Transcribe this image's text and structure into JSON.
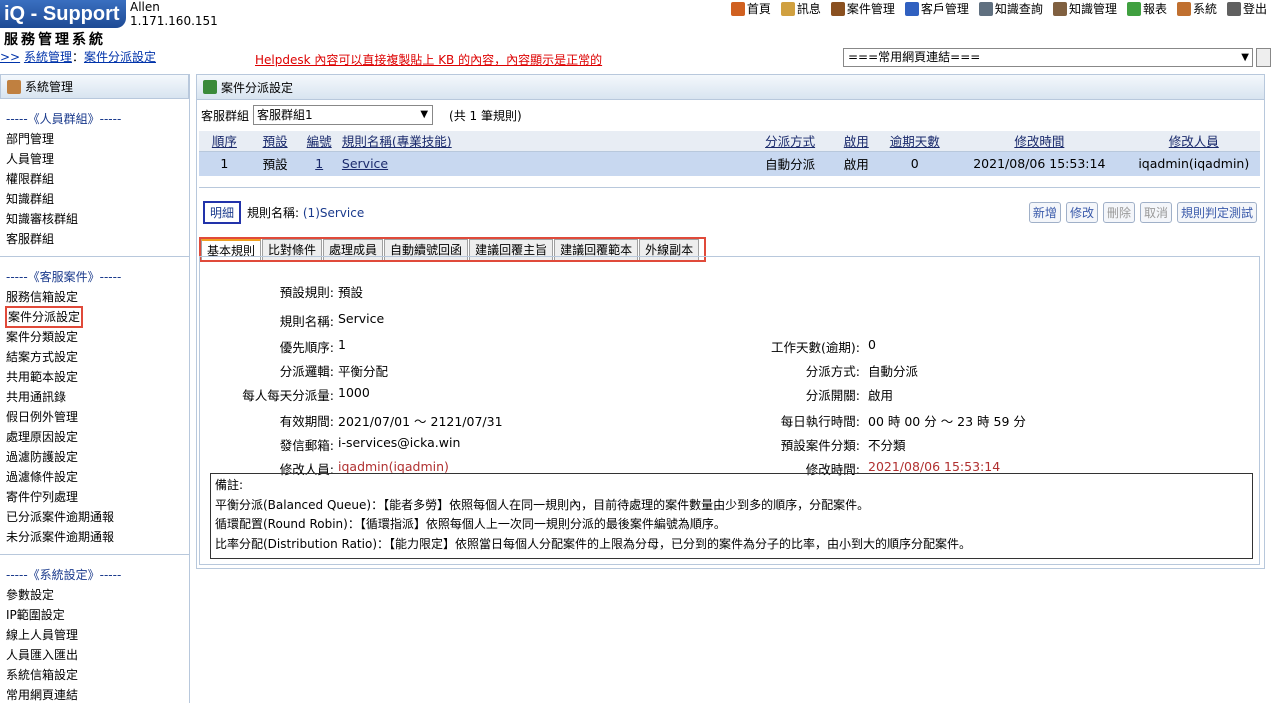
{
  "header": {
    "logo": "iQ - Support",
    "user": "Allen",
    "ip": "1.171.160.151",
    "system_name": "服務管理系統",
    "breadcrumb_prefix": ">>",
    "breadcrumb": [
      {
        "label": "系統管理"
      },
      {
        "label": "案件分派設定"
      }
    ],
    "notice": "Helpdesk 內容可以直接複製貼上 KB 的內容，內容顯示是正常的",
    "nav": [
      {
        "label": "首頁",
        "icon": "home-icon",
        "color": "#d06020"
      },
      {
        "label": "訊息",
        "icon": "mail-icon",
        "color": "#d0a040"
      },
      {
        "label": "案件管理",
        "icon": "case-icon",
        "color": "#8a5020"
      },
      {
        "label": "客戶管理",
        "icon": "customer-icon",
        "color": "#3060c0"
      },
      {
        "label": "知識查詢",
        "icon": "search-icon",
        "color": "#607080"
      },
      {
        "label": "知識管理",
        "icon": "book-icon",
        "color": "#806040"
      },
      {
        "label": "報表",
        "icon": "report-icon",
        "color": "#40a040"
      },
      {
        "label": "系統",
        "icon": "system-icon",
        "color": "#c07030"
      },
      {
        "label": "登出",
        "icon": "logout-icon",
        "color": "#606060"
      }
    ],
    "quick_links": "===常用網頁連結==="
  },
  "sidebar": {
    "title": "系統管理",
    "sections": [
      {
        "title": "-----《人員群組》-----",
        "items": [
          "部門管理",
          "人員管理",
          "權限群組",
          "知識群組",
          "知識審核群組",
          "客服群組"
        ]
      },
      {
        "title": "-----《客服案件》-----",
        "items": [
          "服務信箱設定",
          "案件分派設定",
          "案件分類設定",
          "結案方式設定",
          "共用範本設定",
          "共用通訊錄",
          "假日例外管理",
          "處理原因設定",
          "過濾防護設定",
          "過濾條件設定",
          "寄件佇列處理",
          "已分派案件逾期通報",
          "未分派案件逾期通報"
        ]
      },
      {
        "title": "-----《系統設定》-----",
        "items": [
          "參數設定",
          "IP範圍設定",
          "線上人員管理",
          "人員匯入匯出",
          "系統信箱設定",
          "常用網頁連結"
        ]
      }
    ]
  },
  "main": {
    "title": "案件分派設定",
    "group_label": "客服群組",
    "group_value": "客服群組1",
    "rule_count": "(共 1 筆規則)",
    "table": {
      "headers": [
        "順序",
        "預設",
        "編號",
        "規則名稱(專業技能)",
        "分派方式",
        "啟用",
        "逾期天數",
        "修改時間",
        "修改人員"
      ],
      "rows": [
        [
          "1",
          "預設",
          "1",
          "Service",
          "自動分派",
          "啟用",
          "0",
          "2021/08/06 15:53:14",
          "iqadmin(iqadmin)"
        ]
      ]
    },
    "detail_button": "明細",
    "rule_name_label": "規則名稱:",
    "rule_name_value": "(1)Service",
    "actions": [
      "新增",
      "修改",
      "刪除",
      "取消",
      "規則判定測試"
    ],
    "tabs": [
      "基本規則",
      "比對條件",
      "處理成員",
      "自動續號回函",
      "建議回覆主旨",
      "建議回覆範本",
      "外線副本"
    ],
    "fields": {
      "default_rule_l": "預設規則:",
      "default_rule_v": "預設",
      "rule_name_l": "規則名稱:",
      "rule_name_v": "Service",
      "priority_l": "優先順序:",
      "priority_v": "1",
      "workdays_l": "工作天數(逾期):",
      "workdays_v": "0",
      "logic_l": "分派邏輯:",
      "logic_v": "平衡分配",
      "method_l": "分派方式:",
      "method_v": "自動分派",
      "daily_l": "每人每天分派量:",
      "daily_v": "1000",
      "switch_l": "分派開關:",
      "switch_v": "啟用",
      "period_l": "有效期間:",
      "period_v": "2021/07/01 ～ 2121/07/31",
      "daily_time_l": "每日執行時間:",
      "daily_time_v": "00 時 00 分 ～ 23 時 59 分",
      "mailbox_l": "發信郵箱:",
      "mailbox_v": "i-services@icka.win",
      "category_l": "預設案件分類:",
      "category_v": "不分類",
      "editor_l": "修改人員:",
      "editor_v": "iqadmin(iqadmin)",
      "mtime_l": "修改時間:",
      "mtime_v": "2021/08/06 15:53:14"
    },
    "notes": [
      "備註:",
      "平衡分派(Balanced Queue)：【能者多勞】依照每個人在同一規則內，目前待處理的案件數量由少到多的順序，分配案件。",
      "循環配置(Round Robin)：【循環指派】依照每個人上一次同一規則分派的最後案件編號為順序。",
      "比率分配(Distribution Ratio)：【能力限定】依照當日每個人分配案件的上限為分母，已分到的案件為分子的比率，由小到大的順序分配案件。"
    ]
  }
}
